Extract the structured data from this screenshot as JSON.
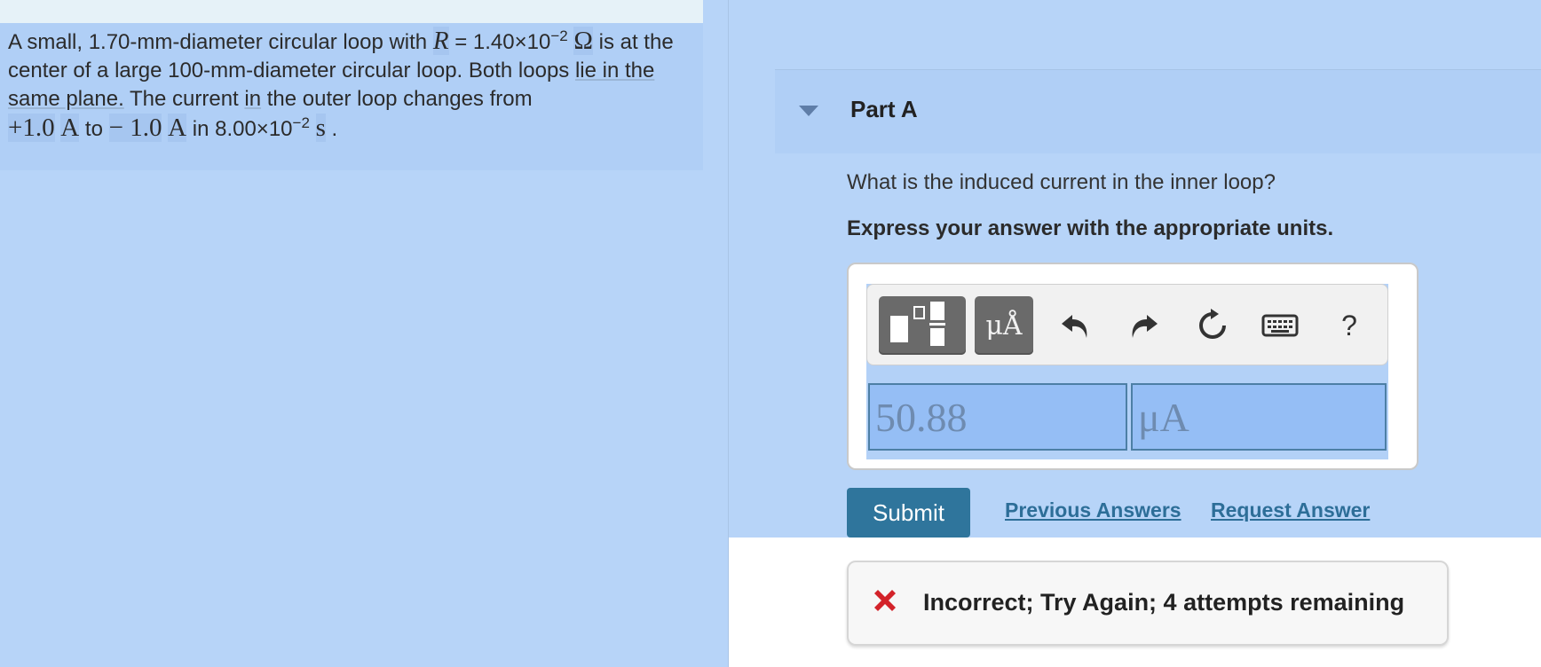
{
  "problem": {
    "p1": "A small, 1.70-mm-diameter circular loop with ",
    "r_symbol": "R",
    "p2": " = 1.40×10",
    "exp1": "−2",
    "ohm": "Ω",
    "p3": " is at the center of a large 100-mm-diameter circular loop. Both loops ",
    "u1": "lie in the same plane.",
    "p4": " The current ",
    "u2": "in",
    "p5": " the outer loop changes from ",
    "plus_val": "+1.0",
    "unit_a1": "A",
    "to": " to ",
    "minus_val": "− 1.0",
    "unit_a2": "A",
    "p6": " in 8.00×10",
    "exp2": "−2",
    "unit_s": "s",
    "period": " ."
  },
  "part": {
    "title": "Part A"
  },
  "question": "What is the induced current in the inner loop?",
  "instruction": "Express your answer with the appropriate units.",
  "toolbar": {
    "units_label": "μÅ",
    "help_label": "?"
  },
  "answer": {
    "value": "50.88",
    "units": "μA"
  },
  "actions": {
    "submit_label": "Submit",
    "previous_answers_label": "Previous Answers",
    "request_answer_label": "Request Answer"
  },
  "feedback": {
    "text": "Incorrect; Try Again; 4 attempts remaining",
    "icon": "x-icon",
    "color": "#d3232a"
  },
  "colors": {
    "background": "#b7d4f8",
    "submit": "#2f759c",
    "link": "#2d6e98"
  }
}
